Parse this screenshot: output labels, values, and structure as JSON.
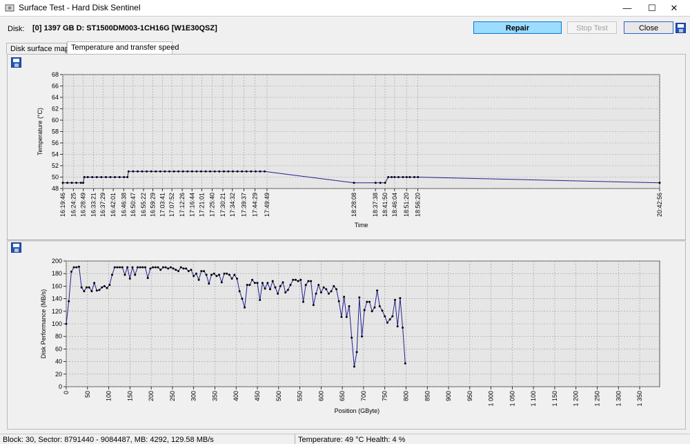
{
  "window": {
    "title": "Surface Test - Hard Disk Sentinel",
    "minimize": "—",
    "maximize": "☐",
    "close": "✕"
  },
  "toolbar": {
    "disk_label": "Disk:",
    "disk_name": "[0] 1397 GB D: ST1500DM003-1CH16G [W1E30QSZ]",
    "repair_label": "Repair",
    "stop_label": "Stop Test",
    "close_label": "Close"
  },
  "tabs": [
    {
      "label": "Disk surface map"
    },
    {
      "label": "Temperature and transfer speed",
      "active": true
    }
  ],
  "status": {
    "left": "Block: 30, Sector: 8791440 - 9084487, MB: 4292, 129.58 MB/s",
    "right": "Temperature: 49 °C  Health: 4 %"
  },
  "colors": {
    "series": "#1f1f8f",
    "point": "#000000",
    "plot_bg": "#e6e6e6",
    "repair_bg": "#9cdcff"
  },
  "chart_data": [
    {
      "type": "line",
      "title": "",
      "xlabel": "Time",
      "ylabel": "Temperature (°C)",
      "ylim": [
        48,
        68
      ],
      "yticks": [
        48,
        50,
        52,
        54,
        56,
        58,
        60,
        62,
        64,
        66,
        68
      ],
      "x_tick_labels": [
        "16:19:46",
        "16:24:25",
        "16:28:49",
        "16:33:21",
        "16:37:29",
        "16:42:01",
        "16:46:38",
        "16:50:47",
        "16:55:22",
        "16:59:29",
        "17:03:41",
        "17:07:52",
        "17:12:26",
        "17:16:44",
        "17:21:01",
        "17:25:40",
        "17:30:21",
        "17:34:32",
        "17:39:37",
        "17:44:29",
        "17:49:49",
        "18:28:08",
        "18:37:38",
        "18:41:50",
        "18:46:04",
        "18:51:20",
        "18:56:20",
        "20:42:56"
      ],
      "x_minutes": [
        0,
        4.65,
        9.05,
        13.58,
        17.72,
        22.25,
        26.87,
        31.02,
        35.6,
        39.72,
        43.92,
        48.1,
        52.67,
        56.97,
        61.25,
        65.9,
        70.58,
        74.77,
        79.85,
        84.72,
        90.05,
        128.37,
        137.87,
        142.07,
        146.3,
        151.57,
        156.57,
        263.17
      ],
      "x_range_minutes": [
        0,
        263.17
      ],
      "series": [
        {
          "points": [
            [
              0,
              49
            ],
            [
              2,
              49
            ],
            [
              4,
              49
            ],
            [
              6,
              49
            ],
            [
              8,
              49
            ],
            [
              9,
              49
            ],
            [
              9.5,
              50
            ],
            [
              11,
              50
            ],
            [
              13,
              50
            ],
            [
              15,
              50
            ],
            [
              17,
              50
            ],
            [
              19,
              50
            ],
            [
              21,
              50
            ],
            [
              23,
              50
            ],
            [
              25,
              50
            ],
            [
              27,
              50
            ],
            [
              28.5,
              50
            ],
            [
              29,
              51
            ],
            [
              31,
              51
            ],
            [
              33,
              51
            ],
            [
              35,
              51
            ],
            [
              37,
              51
            ],
            [
              39,
              51
            ],
            [
              41,
              51
            ],
            [
              43,
              51
            ],
            [
              45,
              51
            ],
            [
              47,
              51
            ],
            [
              49,
              51
            ],
            [
              51,
              51
            ],
            [
              53,
              51
            ],
            [
              55,
              51
            ],
            [
              57,
              51
            ],
            [
              59,
              51
            ],
            [
              61,
              51
            ],
            [
              63,
              51
            ],
            [
              65,
              51
            ],
            [
              67,
              51
            ],
            [
              69,
              51
            ],
            [
              71,
              51
            ],
            [
              73,
              51
            ],
            [
              75,
              51
            ],
            [
              77,
              51
            ],
            [
              79,
              51
            ],
            [
              81,
              51
            ],
            [
              83,
              51
            ],
            [
              85,
              51
            ],
            [
              87,
              51
            ],
            [
              89,
              51
            ],
            [
              128.4,
              49
            ],
            [
              137.9,
              49
            ],
            [
              140,
              49
            ],
            [
              142.1,
              49
            ],
            [
              143.5,
              50
            ],
            [
              145,
              50
            ],
            [
              146.3,
              50
            ],
            [
              148,
              50
            ],
            [
              150,
              50
            ],
            [
              151.6,
              50
            ],
            [
              153,
              50
            ],
            [
              155,
              50
            ],
            [
              156.6,
              50
            ],
            [
              263.17,
              49
            ]
          ]
        }
      ]
    },
    {
      "type": "line",
      "title": "",
      "xlabel": "Position (GByte)",
      "ylabel": "Disk Performance (MB/s)",
      "ylim": [
        0,
        200
      ],
      "yticks": [
        0,
        20,
        40,
        60,
        80,
        100,
        120,
        140,
        160,
        180,
        200
      ],
      "xlim": [
        0,
        1397
      ],
      "xticks": [
        0,
        50,
        100,
        150,
        200,
        250,
        300,
        350,
        400,
        450,
        500,
        550,
        600,
        650,
        700,
        750,
        800,
        850,
        900,
        950,
        1000,
        1050,
        1100,
        1150,
        1200,
        1250,
        1300,
        1350
      ],
      "x_tick_labels": [
        "0",
        "50",
        "100",
        "150",
        "200",
        "250",
        "300",
        "350",
        "400",
        "450",
        "500",
        "550",
        "600",
        "650",
        "700",
        "750",
        "800",
        "850",
        "900",
        "950",
        "1 000",
        "1 050",
        "1 100",
        "1 150",
        "1 200",
        "1 250",
        "1 300",
        "1 350"
      ],
      "series": [
        {
          "points": [
            [
              0,
              100
            ],
            [
              6,
              136
            ],
            [
              12,
              183
            ],
            [
              18,
              190
            ],
            [
              24,
              190
            ],
            [
              30,
              191
            ],
            [
              36,
              158
            ],
            [
              42,
              152
            ],
            [
              48,
              158
            ],
            [
              54,
              158
            ],
            [
              60,
              152
            ],
            [
              66,
              165
            ],
            [
              72,
              153
            ],
            [
              78,
              154
            ],
            [
              84,
              158
            ],
            [
              90,
              160
            ],
            [
              96,
              157
            ],
            [
              102,
              162
            ],
            [
              108,
              178
            ],
            [
              114,
              190
            ],
            [
              120,
              190
            ],
            [
              126,
              190
            ],
            [
              132,
              190
            ],
            [
              138,
              178
            ],
            [
              144,
              190
            ],
            [
              150,
              172
            ],
            [
              156,
              190
            ],
            [
              162,
              178
            ],
            [
              168,
              190
            ],
            [
              174,
              190
            ],
            [
              180,
              190
            ],
            [
              186,
              190
            ],
            [
              192,
              173
            ],
            [
              198,
              188
            ],
            [
              204,
              190
            ],
            [
              210,
              190
            ],
            [
              216,
              190
            ],
            [
              222,
              186
            ],
            [
              228,
              190
            ],
            [
              234,
              190
            ],
            [
              240,
              188
            ],
            [
              246,
              190
            ],
            [
              252,
              188
            ],
            [
              258,
              186
            ],
            [
              264,
              184
            ],
            [
              270,
              190
            ],
            [
              276,
              188
            ],
            [
              282,
              188
            ],
            [
              288,
              184
            ],
            [
              294,
              186
            ],
            [
              300,
              176
            ],
            [
              306,
              180
            ],
            [
              312,
              170
            ],
            [
              318,
              184
            ],
            [
              324,
              184
            ],
            [
              330,
              178
            ],
            [
              336,
              164
            ],
            [
              342,
              178
            ],
            [
              348,
              180
            ],
            [
              354,
              176
            ],
            [
              360,
              178
            ],
            [
              366,
              166
            ],
            [
              372,
              180
            ],
            [
              378,
              180
            ],
            [
              384,
              178
            ],
            [
              390,
              172
            ],
            [
              396,
              178
            ],
            [
              402,
              172
            ],
            [
              408,
              152
            ],
            [
              414,
              140
            ],
            [
              420,
              126
            ],
            [
              426,
              162
            ],
            [
              432,
              162
            ],
            [
              438,
              170
            ],
            [
              444,
              165
            ],
            [
              450,
              165
            ],
            [
              456,
              138
            ],
            [
              462,
              165
            ],
            [
              468,
              156
            ],
            [
              474,
              165
            ],
            [
              480,
              155
            ],
            [
              486,
              168
            ],
            [
              492,
              158
            ],
            [
              498,
              148
            ],
            [
              504,
              160
            ],
            [
              510,
              166
            ],
            [
              516,
              150
            ],
            [
              522,
              154
            ],
            [
              528,
              162
            ],
            [
              534,
              170
            ],
            [
              540,
              170
            ],
            [
              546,
              168
            ],
            [
              552,
              170
            ],
            [
              558,
              135
            ],
            [
              564,
              162
            ],
            [
              570,
              168
            ],
            [
              576,
              168
            ],
            [
              582,
              130
            ],
            [
              588,
              148
            ],
            [
              594,
              162
            ],
            [
              600,
              150
            ],
            [
              606,
              158
            ],
            [
              612,
              155
            ],
            [
              618,
              148
            ],
            [
              624,
              152
            ],
            [
              630,
              160
            ],
            [
              636,
              155
            ],
            [
              642,
              136
            ],
            [
              648,
              111
            ],
            [
              654,
              143
            ],
            [
              660,
              111
            ],
            [
              666,
              128
            ],
            [
              672,
              78
            ],
            [
              678,
              32
            ],
            [
              684,
              55
            ],
            [
              690,
              142
            ],
            [
              696,
              80
            ],
            [
              702,
              122
            ],
            [
              708,
              135
            ],
            [
              714,
              135
            ],
            [
              720,
              120
            ],
            [
              726,
              126
            ],
            [
              732,
              153
            ],
            [
              738,
              128
            ],
            [
              744,
              121
            ],
            [
              750,
              112
            ],
            [
              756,
              102
            ],
            [
              762,
              107
            ],
            [
              768,
              112
            ],
            [
              774,
              138
            ],
            [
              780,
              96
            ],
            [
              786,
              141
            ],
            [
              792,
              94
            ],
            [
              798,
              37
            ]
          ]
        }
      ]
    }
  ]
}
